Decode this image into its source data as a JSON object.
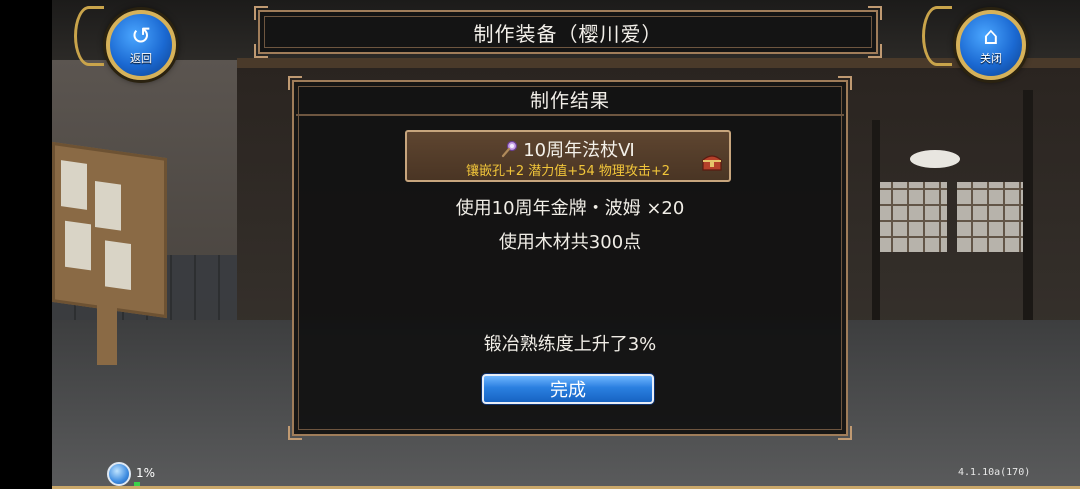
{
  "header": {
    "title": "制作装备（樱川爱）",
    "back_button": {
      "label": "返回",
      "icon": "back-arrow-icon"
    },
    "close_button": {
      "label": "关闭",
      "icon": "home-icon"
    }
  },
  "dialog": {
    "title": "制作结果",
    "item": {
      "name": "10周年法杖Ⅵ",
      "icon": "staff-icon",
      "stats": "镶嵌孔+2  潜力值+54  物理攻击+2",
      "badge_icon": "treasure-chest-icon"
    },
    "materials": [
      "使用10周年金牌・波姆  ×20",
      "使用木材共300点"
    ],
    "skill_message": "锻冶熟练度上升了3%",
    "confirm_label": "完成"
  },
  "status": {
    "progress_text": "1%",
    "progress": 0.01,
    "version": "4.1.10a(170)"
  },
  "colors": {
    "frame": "#a07d5a",
    "stats_text": "#f2c63a",
    "button_blue": "#2a7fe0"
  }
}
